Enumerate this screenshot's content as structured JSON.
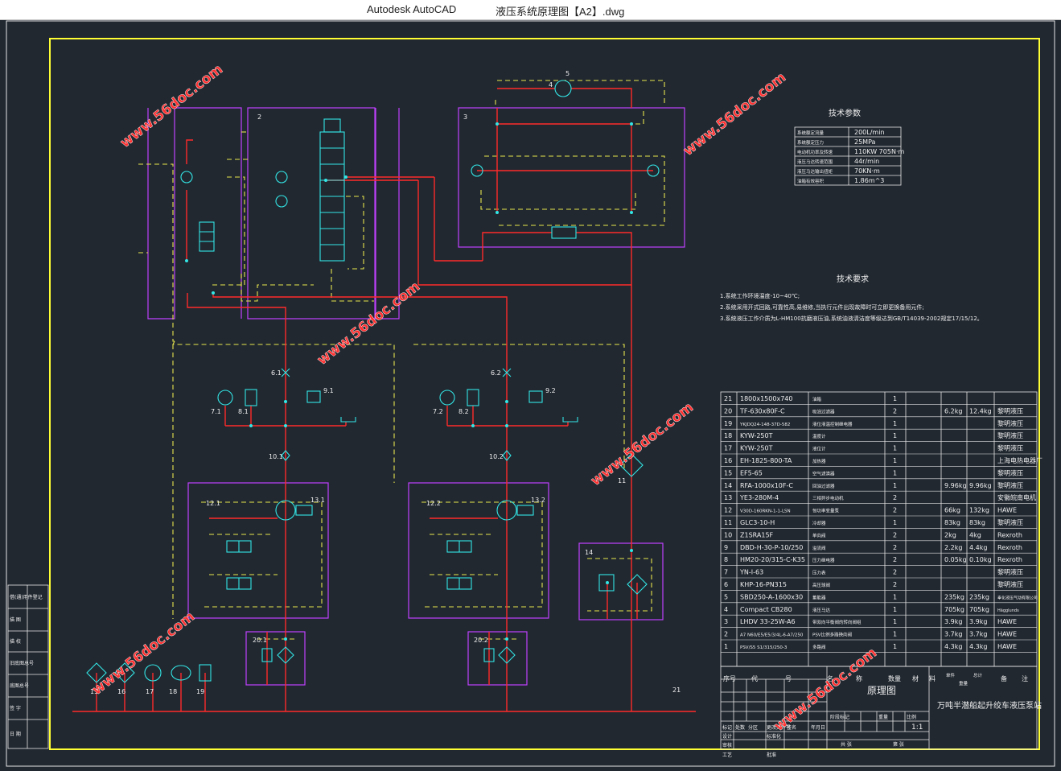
{
  "window": {
    "app_name": "Autodesk AutoCAD",
    "file_name": "液压系统原理图【A2】.dwg"
  },
  "colors": {
    "background": "#212830",
    "frame_white": "#e8e8e8",
    "frame_yellow": "#ffff33",
    "pipe_red": "#ff2a2a",
    "dashed_yellow": "#e6e64d",
    "boundary_magenta": "#c040ff",
    "symbol_cyan": "#33e6e6",
    "text_white": "#f0f0f0",
    "watermark": "#ff3030"
  },
  "watermark_text": "www.56doc.com",
  "schematic": {
    "labels": [
      "2",
      "3",
      "4",
      "5",
      "6.1",
      "6.2",
      "7.1",
      "7.2",
      "8.1",
      "8.2",
      "9.1",
      "9.2",
      "10.1",
      "10.2",
      "11",
      "12.1",
      "12.2",
      "13.1",
      "13.2",
      "14",
      "15",
      "16",
      "17",
      "18",
      "19",
      "20.1",
      "20.2",
      "21"
    ]
  },
  "tech_params": {
    "title": "技术参数",
    "rows": [
      {
        "name": "系统额定流量",
        "value": "200L/min"
      },
      {
        "name": "系统额定压力",
        "value": "25MPa"
      },
      {
        "name": "电动机功率及转速",
        "value": "110KW 705N·m"
      },
      {
        "name": "液压马达转速范围",
        "value": "44r/min"
      },
      {
        "name": "液压马达输出扭矩",
        "value": "70KN·m"
      },
      {
        "name": "油箱有效容积",
        "value": "1.86m^3"
      }
    ]
  },
  "tech_requirements": {
    "title": "技术要求",
    "lines": [
      "1.系统工作环境温度-10~40℃;",
      "2.系统采用开式回路,可靠性高,易维修,当执行元件出现故障时可立即更换备用元件;",
      "3.系统液压工作介质为L-HM100抗磨液压油,系统油液清洁度等级达到GB/T14039-2002规定17/15/12。"
    ]
  },
  "bom": {
    "headers": [
      "序号",
      "代",
      "号",
      "名",
      "称",
      "数量",
      "材",
      "料",
      "单件",
      "总计",
      "重量",
      "备",
      "注"
    ],
    "rows": [
      {
        "no": "21",
        "code": "1800x1500x740",
        "name": "油箱",
        "qty": "1",
        "w1": "",
        "w2": "",
        "note": ""
      },
      {
        "no": "20",
        "code": "TF-630x80F-C",
        "name": "吸油过滤器",
        "qty": "2",
        "w1": "6.2kg",
        "w2": "12.4kg",
        "note": "黎明液压"
      },
      {
        "no": "19",
        "code": "YKJDQ24-148-37D-582",
        "name": "液位液温控制继电器",
        "qty": "1",
        "w1": "",
        "w2": "",
        "note": "黎明液压"
      },
      {
        "no": "18",
        "code": "KYW-250T",
        "name": "温度计",
        "qty": "1",
        "w1": "",
        "w2": "",
        "note": "黎明液压"
      },
      {
        "no": "17",
        "code": "KYW-250T",
        "name": "液位计",
        "qty": "1",
        "w1": "",
        "w2": "",
        "note": "黎明液压"
      },
      {
        "no": "16",
        "code": "EH-1825-800-TA",
        "name": "加热器",
        "qty": "1",
        "w1": "",
        "w2": "",
        "note": "上海电热电器厂"
      },
      {
        "no": "15",
        "code": "EF5-65",
        "name": "空气滤清器",
        "qty": "1",
        "w1": "",
        "w2": "",
        "note": "黎明液压"
      },
      {
        "no": "14",
        "code": "RFA-1000x10F-C",
        "name": "回油过滤器",
        "qty": "1",
        "w1": "9.96kg",
        "w2": "9.96kg",
        "note": "黎明液压"
      },
      {
        "no": "13",
        "code": "YE3-280M-4",
        "name": "三相异步电动机",
        "qty": "2",
        "w1": "",
        "w2": "",
        "note": "安徽皖南电机"
      },
      {
        "no": "12",
        "code": "V30D-160RKN-1-1-LSN",
        "name": "恒功率变量泵",
        "qty": "2",
        "w1": "66kg",
        "w2": "132kg",
        "note": "HAWE"
      },
      {
        "no": "11",
        "code": "GLC3-10-H",
        "name": "冷却器",
        "qty": "1",
        "w1": "83kg",
        "w2": "83kg",
        "note": "黎明液压"
      },
      {
        "no": "10",
        "code": "Z1SRA15F",
        "name": "单向阀",
        "qty": "2",
        "w1": "2kg",
        "w2": "4kg",
        "note": "Rexroth"
      },
      {
        "no": "9",
        "code": "DBD-H-30-P-10/250",
        "name": "溢流阀",
        "qty": "2",
        "w1": "2.2kg",
        "w2": "4.4kg",
        "note": "Rexroth"
      },
      {
        "no": "8",
        "code": "HM20-20/315-C-K35",
        "name": "压力继电器",
        "qty": "2",
        "w1": "0.05kg",
        "w2": "0.10kg",
        "note": "Rexroth"
      },
      {
        "no": "7",
        "code": "YN-I-63",
        "name": "压力表",
        "qty": "2",
        "w1": "",
        "w2": "",
        "note": "黎明液压"
      },
      {
        "no": "6",
        "code": "KHP-16-PN315",
        "name": "高压球阀",
        "qty": "2",
        "w1": "",
        "w2": "",
        "note": "黎明液压"
      },
      {
        "no": "5",
        "code": "SBD250-A-1600x30",
        "name": "蓄能器",
        "qty": "1",
        "w1": "235kg",
        "w2": "235kg",
        "note": "奉化液压气动有限公司"
      },
      {
        "no": "4",
        "code": "Compact CB280",
        "name": "液压马达",
        "qty": "1",
        "w1": "705kg",
        "w2": "705kg",
        "note": "Hägglunds"
      },
      {
        "no": "3",
        "code": "LHDV 33-25W-A6",
        "name": "带双向平衡阀的转向阀组",
        "qty": "1",
        "w1": "3.9kg",
        "w2": "3.9kg",
        "note": "HAWE"
      },
      {
        "no": "2",
        "code": "A7 N60/E5/E5/3/4L-6-A7/250",
        "name": "PSV比例多路换向阀",
        "qty": "1",
        "w1": "3.7kg",
        "w2": "3.7kg",
        "note": "HAWE"
      },
      {
        "no": "1",
        "code": "PSV/S5 S1/315/250-3",
        "name": "多路阀",
        "qty": "1",
        "w1": "4.3kg",
        "w2": "4.3kg",
        "note": "HAWE"
      }
    ]
  },
  "title_block": {
    "drawing_name": "原理图",
    "project_name": "万吨半潜船起升绞车液压泵站",
    "scale": "1:1",
    "labels": {
      "mark": "标记",
      "count": "处数",
      "zone": "分区",
      "change_doc": "更改文件号",
      "sign": "签名",
      "date": "年月日",
      "design": "设计",
      "standardize": "标准化",
      "stage_mark": "阶段标记",
      "weight": "重量",
      "ratio": "比例",
      "review": "审核",
      "process": "工艺",
      "approve": "批准",
      "sheet_total": "共  张",
      "sheet": "第  张"
    },
    "side_labels": [
      "借(通)用件登记",
      "描  图",
      "描  校",
      "旧底图总号",
      "底图总号",
      "签  字",
      "日  期"
    ]
  }
}
